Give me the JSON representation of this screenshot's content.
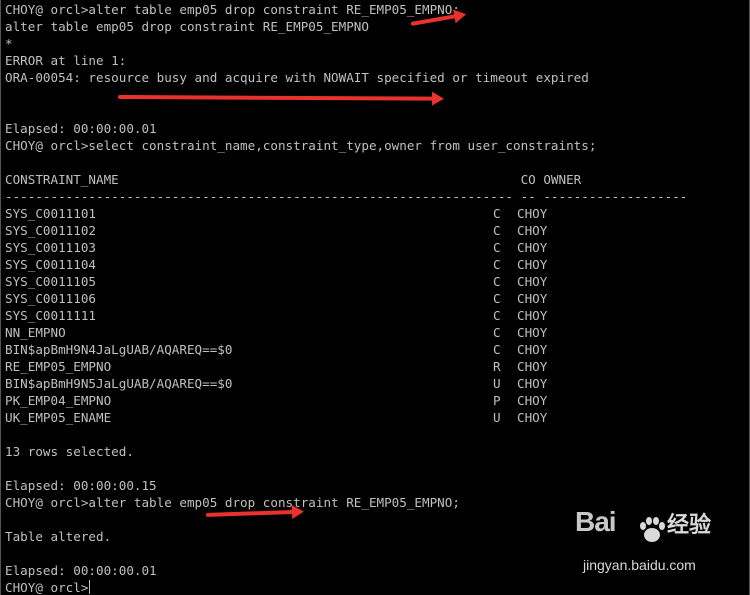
{
  "terminal": {
    "lines": [
      "CHOY@ orcl>alter table emp05 drop constraint RE_EMP05_EMPNO;",
      "alter table emp05 drop constraint RE_EMP05_EMPNO",
      "*",
      "ERROR at line 1:",
      "ORA-00054: resource busy and acquire with NOWAIT specified or timeout expired",
      "",
      "",
      "Elapsed: 00:00:00.01",
      "CHOY@ orcl>select constraint_name,constraint_type,owner from user_constraints;",
      "",
      "CONSTRAINT_NAME                                                     CO OWNER",
      "------------------------------------------------------------------- -- -------------------"
    ],
    "rows": [
      {
        "name": "SYS_C0011101",
        "type": "C",
        "owner": "CHOY"
      },
      {
        "name": "SYS_C0011102",
        "type": "C",
        "owner": "CHOY"
      },
      {
        "name": "SYS_C0011103",
        "type": "C",
        "owner": "CHOY"
      },
      {
        "name": "SYS_C0011104",
        "type": "C",
        "owner": "CHOY"
      },
      {
        "name": "SYS_C0011105",
        "type": "C",
        "owner": "CHOY"
      },
      {
        "name": "SYS_C0011106",
        "type": "C",
        "owner": "CHOY"
      },
      {
        "name": "SYS_C0011111",
        "type": "C",
        "owner": "CHOY"
      },
      {
        "name": "NN_EMPNO",
        "type": "C",
        "owner": "CHOY"
      },
      {
        "name": "BIN$apBmH9N4JaLgUAB/AQAREQ==$0",
        "type": "C",
        "owner": "CHOY"
      },
      {
        "name": "RE_EMP05_EMPNO",
        "type": "R",
        "owner": "CHOY"
      },
      {
        "name": "BIN$apBmH9N5JaLgUAB/AQAREQ==$0",
        "type": "U",
        "owner": "CHOY"
      },
      {
        "name": "PK_EMP04_EMPNO",
        "type": "P",
        "owner": "CHOY"
      },
      {
        "name": "UK_EMP05_ENAME",
        "type": "U",
        "owner": "CHOY"
      }
    ],
    "after_lines": [
      "",
      "13 rows selected.",
      "",
      "Elapsed: 00:00:00.15",
      "CHOY@ orcl>alter table emp05 drop constraint RE_EMP05_EMPNO;",
      "",
      "Table altered.",
      "",
      "Elapsed: 00:00:00.01"
    ],
    "prompt": "CHOY@ orcl>"
  },
  "watermark": {
    "logo": "Bai",
    "cn": "经验",
    "url": "jingyan.baidu.com"
  },
  "colors": {
    "background": "#000000",
    "text": "#c0c0c0",
    "arrow": "#e8322c"
  }
}
